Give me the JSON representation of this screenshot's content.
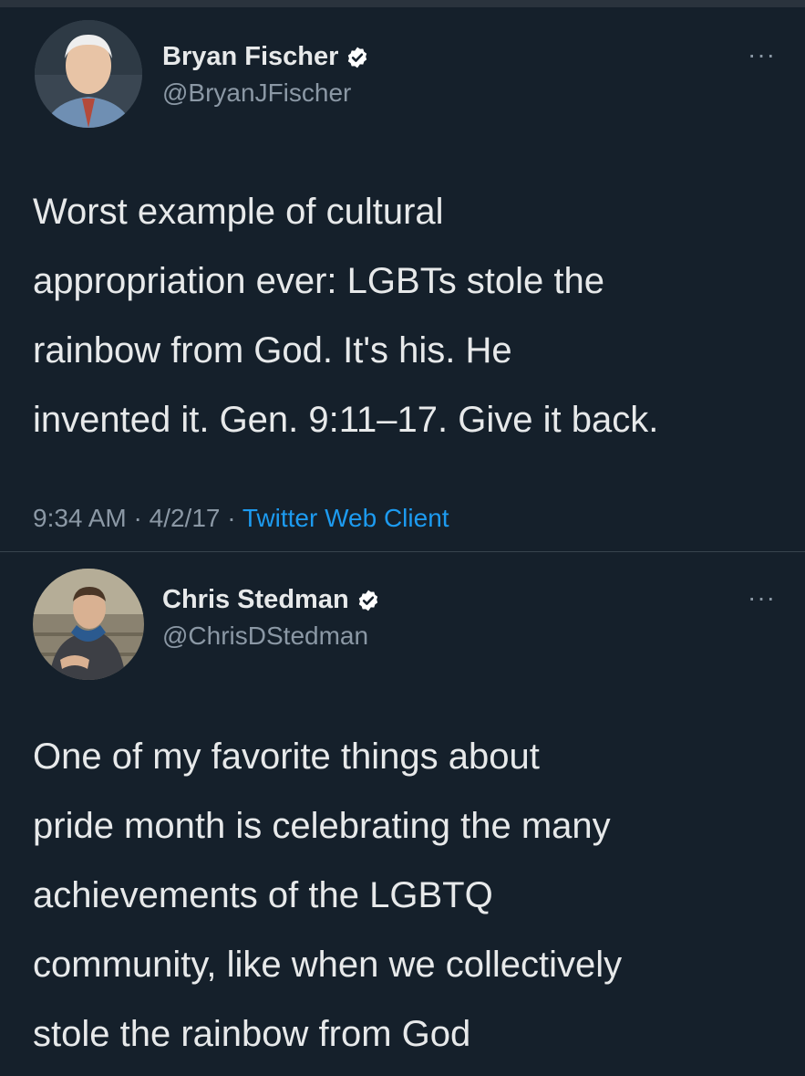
{
  "tweets": [
    {
      "display_name": "Bryan Fischer",
      "handle": "@BryanJFischer",
      "lines": [
        "Worst example of cultural",
        "appropriation ever: LGBTs stole the",
        "rainbow from God. It's his. He",
        "invented it. Gen. 9:11–17. Give it back."
      ],
      "time": "9:34 AM",
      "date": "4/2/17",
      "source": "Twitter Web Client",
      "more": "···",
      "verified_icon": "verified-badge-icon"
    },
    {
      "display_name": "Chris Stedman",
      "handle": "@ChrisDStedman",
      "lines": [
        "One of my favorite things about",
        "pride month is celebrating the many",
        "achievements of the LGBTQ",
        "community, like when we collectively",
        "stole the rainbow from God"
      ],
      "more": "···",
      "verified_icon": "verified-badge-icon"
    }
  ],
  "meta_separator": "·",
  "colors": {
    "background": "#15202b",
    "text": "#e7e9ea",
    "muted": "#8b98a5",
    "link": "#1d9bf0",
    "divider": "#38444d"
  }
}
